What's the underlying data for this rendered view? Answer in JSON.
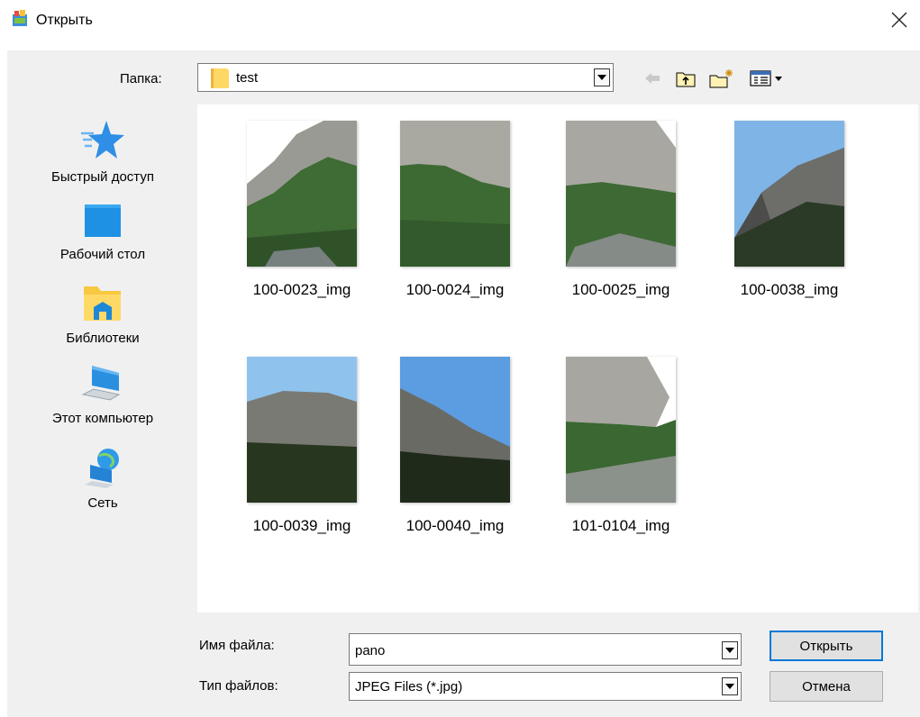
{
  "window": {
    "title": "Открыть"
  },
  "folder": {
    "label": "Папка:",
    "current": "test"
  },
  "toolbar": {
    "back": "back-arrow-icon",
    "up": "folder-up-icon",
    "new_folder": "new-folder-icon",
    "view": "view-menu-icon"
  },
  "places": [
    {
      "label": "Быстрый доступ",
      "icon": "star-icon"
    },
    {
      "label": "Рабочий стол",
      "icon": "desktop-icon"
    },
    {
      "label": "Библиотеки",
      "icon": "libraries-icon"
    },
    {
      "label": "Этот компьютер",
      "icon": "computer-icon"
    },
    {
      "label": "Сеть",
      "icon": "network-icon"
    }
  ],
  "files": [
    {
      "name": "100-0023_img"
    },
    {
      "name": "100-0024_img"
    },
    {
      "name": "100-0025_img"
    },
    {
      "name": "100-0038_img"
    },
    {
      "name": "100-0039_img"
    },
    {
      "name": "100-0040_img"
    },
    {
      "name": "101-0104_img"
    }
  ],
  "filename": {
    "label": "Имя файла:",
    "value": "pano"
  },
  "filetype": {
    "label": "Тип файлов:",
    "value": "JPEG Files (*.jpg)"
  },
  "buttons": {
    "open": "Открыть",
    "cancel": "Отмена"
  },
  "colors": {
    "accent": "#0078d7",
    "dialog_bg": "#f0f0f0",
    "folder": "#ffd764"
  }
}
